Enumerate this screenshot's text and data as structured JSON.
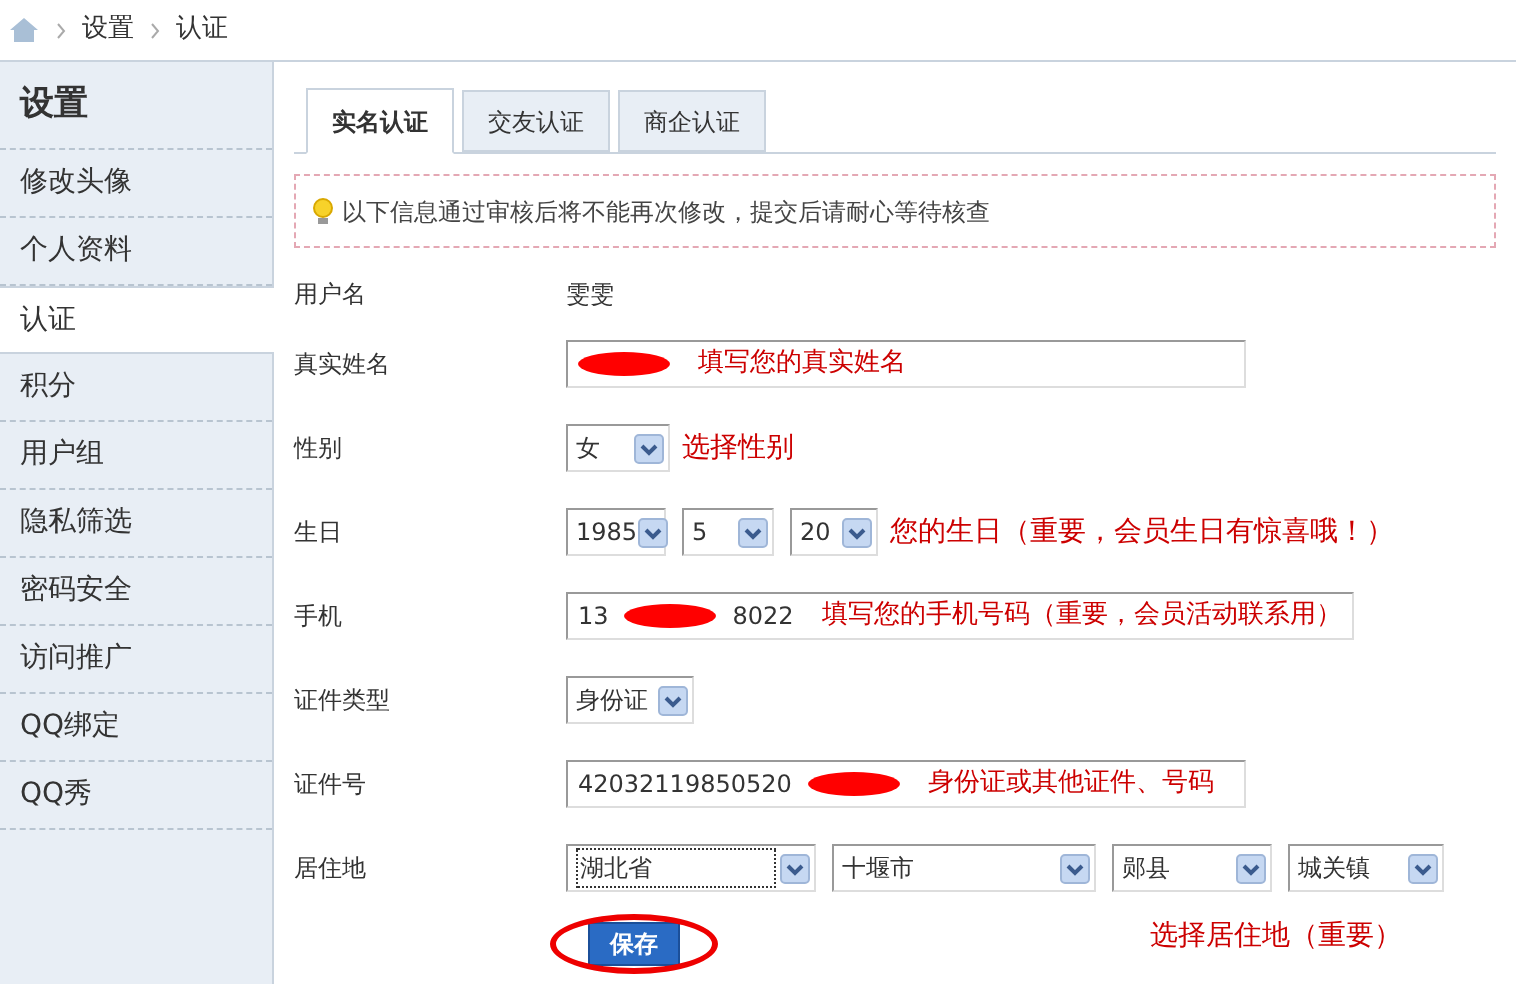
{
  "breadcrumb": [
    "设置",
    "认证"
  ],
  "sidebar": {
    "title": "设置",
    "items": [
      {
        "label": "修改头像",
        "selected": false
      },
      {
        "label": "个人资料",
        "selected": false
      },
      {
        "label": "认证",
        "selected": true
      },
      {
        "label": "积分",
        "selected": false
      },
      {
        "label": "用户组",
        "selected": false
      },
      {
        "label": "隐私筛选",
        "selected": false
      },
      {
        "label": "密码安全",
        "selected": false
      },
      {
        "label": "访问推广",
        "selected": false
      },
      {
        "label": "QQ绑定",
        "selected": false
      },
      {
        "label": "QQ秀",
        "selected": false
      }
    ]
  },
  "tabs": [
    {
      "label": "实名认证",
      "selected": true
    },
    {
      "label": "交友认证",
      "selected": false
    },
    {
      "label": "商企认证",
      "selected": false
    }
  ],
  "notice": "以下信息通过审核后将不能再次修改，提交后请耐心等待核查",
  "form": [
    {
      "kind": "text",
      "label": "用户名",
      "value": "雯雯"
    },
    {
      "kind": "input",
      "label": "真实姓名",
      "redacted": true,
      "note": "填写您的真实姓名"
    },
    {
      "kind": "selects",
      "label": "性别",
      "selects": [
        {
          "value": "女"
        }
      ],
      "note": "选择性别"
    },
    {
      "kind": "selects",
      "label": "生日",
      "selects": [
        {
          "value": "1985"
        },
        {
          "value": "5"
        },
        {
          "value": "20"
        }
      ],
      "note": "您的生日（重要，会员生日有惊喜哦！）"
    },
    {
      "kind": "input",
      "label": "手机",
      "value": "13",
      "value_end": "8022",
      "redacted": true,
      "note": "填写您的手机号码（重要，会员活动联系用）"
    },
    {
      "kind": "selects",
      "label": "证件类型",
      "selects": [
        {
          "value": "身份证"
        }
      ]
    },
    {
      "kind": "input",
      "label": "证件号",
      "value": "42032119850520",
      "redacted": true,
      "note": "身份证或其他证件、号码"
    },
    {
      "kind": "selects",
      "label": "居住地",
      "selects": [
        {
          "value": "湖北省",
          "focused": true
        },
        {
          "value": "十堰市"
        },
        {
          "value": "郧县"
        },
        {
          "value": "城关镇"
        }
      ],
      "note": "选择居住地（重要）"
    }
  ],
  "save_button": {
    "label": "保存",
    "circled": true
  }
}
